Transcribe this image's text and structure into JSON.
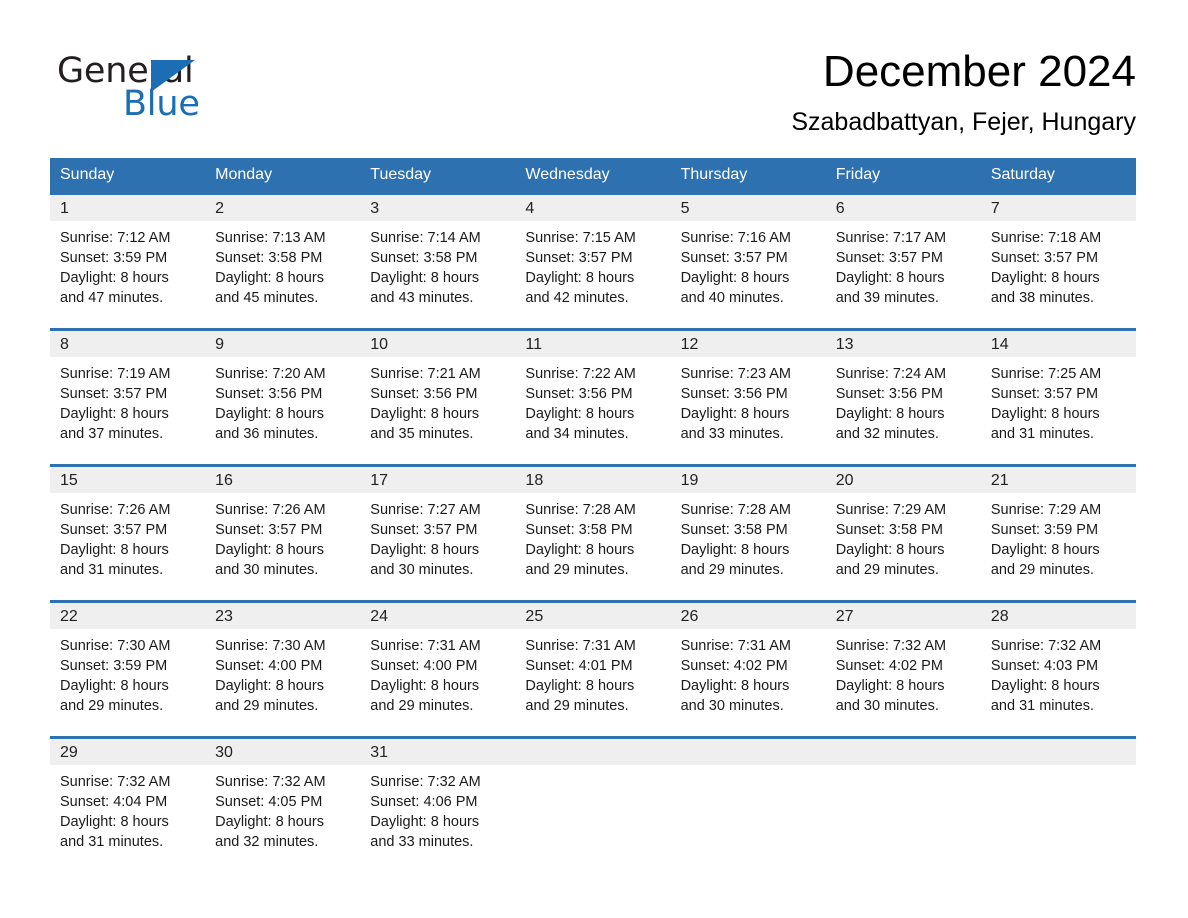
{
  "brand": {
    "name_part1": "General",
    "name_part2": "Blue",
    "accent_color": "#1b6eb3"
  },
  "header": {
    "title": "December 2024",
    "subtitle": "Szabadbattyan, Fejer, Hungary"
  },
  "calendar": {
    "header_color": "#2e71b0",
    "date_strip_color": "#efefef",
    "weekdays": [
      "Sunday",
      "Monday",
      "Tuesday",
      "Wednesday",
      "Thursday",
      "Friday",
      "Saturday"
    ],
    "weeks": [
      [
        {
          "date": "1",
          "sunrise": "Sunrise: 7:12 AM",
          "sunset": "Sunset: 3:59 PM",
          "daylight_line1": "Daylight: 8 hours",
          "daylight_line2": "and 47 minutes."
        },
        {
          "date": "2",
          "sunrise": "Sunrise: 7:13 AM",
          "sunset": "Sunset: 3:58 PM",
          "daylight_line1": "Daylight: 8 hours",
          "daylight_line2": "and 45 minutes."
        },
        {
          "date": "3",
          "sunrise": "Sunrise: 7:14 AM",
          "sunset": "Sunset: 3:58 PM",
          "daylight_line1": "Daylight: 8 hours",
          "daylight_line2": "and 43 minutes."
        },
        {
          "date": "4",
          "sunrise": "Sunrise: 7:15 AM",
          "sunset": "Sunset: 3:57 PM",
          "daylight_line1": "Daylight: 8 hours",
          "daylight_line2": "and 42 minutes."
        },
        {
          "date": "5",
          "sunrise": "Sunrise: 7:16 AM",
          "sunset": "Sunset: 3:57 PM",
          "daylight_line1": "Daylight: 8 hours",
          "daylight_line2": "and 40 minutes."
        },
        {
          "date": "6",
          "sunrise": "Sunrise: 7:17 AM",
          "sunset": "Sunset: 3:57 PM",
          "daylight_line1": "Daylight: 8 hours",
          "daylight_line2": "and 39 minutes."
        },
        {
          "date": "7",
          "sunrise": "Sunrise: 7:18 AM",
          "sunset": "Sunset: 3:57 PM",
          "daylight_line1": "Daylight: 8 hours",
          "daylight_line2": "and 38 minutes."
        }
      ],
      [
        {
          "date": "8",
          "sunrise": "Sunrise: 7:19 AM",
          "sunset": "Sunset: 3:57 PM",
          "daylight_line1": "Daylight: 8 hours",
          "daylight_line2": "and 37 minutes."
        },
        {
          "date": "9",
          "sunrise": "Sunrise: 7:20 AM",
          "sunset": "Sunset: 3:56 PM",
          "daylight_line1": "Daylight: 8 hours",
          "daylight_line2": "and 36 minutes."
        },
        {
          "date": "10",
          "sunrise": "Sunrise: 7:21 AM",
          "sunset": "Sunset: 3:56 PM",
          "daylight_line1": "Daylight: 8 hours",
          "daylight_line2": "and 35 minutes."
        },
        {
          "date": "11",
          "sunrise": "Sunrise: 7:22 AM",
          "sunset": "Sunset: 3:56 PM",
          "daylight_line1": "Daylight: 8 hours",
          "daylight_line2": "and 34 minutes."
        },
        {
          "date": "12",
          "sunrise": "Sunrise: 7:23 AM",
          "sunset": "Sunset: 3:56 PM",
          "daylight_line1": "Daylight: 8 hours",
          "daylight_line2": "and 33 minutes."
        },
        {
          "date": "13",
          "sunrise": "Sunrise: 7:24 AM",
          "sunset": "Sunset: 3:56 PM",
          "daylight_line1": "Daylight: 8 hours",
          "daylight_line2": "and 32 minutes."
        },
        {
          "date": "14",
          "sunrise": "Sunrise: 7:25 AM",
          "sunset": "Sunset: 3:57 PM",
          "daylight_line1": "Daylight: 8 hours",
          "daylight_line2": "and 31 minutes."
        }
      ],
      [
        {
          "date": "15",
          "sunrise": "Sunrise: 7:26 AM",
          "sunset": "Sunset: 3:57 PM",
          "daylight_line1": "Daylight: 8 hours",
          "daylight_line2": "and 31 minutes."
        },
        {
          "date": "16",
          "sunrise": "Sunrise: 7:26 AM",
          "sunset": "Sunset: 3:57 PM",
          "daylight_line1": "Daylight: 8 hours",
          "daylight_line2": "and 30 minutes."
        },
        {
          "date": "17",
          "sunrise": "Sunrise: 7:27 AM",
          "sunset": "Sunset: 3:57 PM",
          "daylight_line1": "Daylight: 8 hours",
          "daylight_line2": "and 30 minutes."
        },
        {
          "date": "18",
          "sunrise": "Sunrise: 7:28 AM",
          "sunset": "Sunset: 3:58 PM",
          "daylight_line1": "Daylight: 8 hours",
          "daylight_line2": "and 29 minutes."
        },
        {
          "date": "19",
          "sunrise": "Sunrise: 7:28 AM",
          "sunset": "Sunset: 3:58 PM",
          "daylight_line1": "Daylight: 8 hours",
          "daylight_line2": "and 29 minutes."
        },
        {
          "date": "20",
          "sunrise": "Sunrise: 7:29 AM",
          "sunset": "Sunset: 3:58 PM",
          "daylight_line1": "Daylight: 8 hours",
          "daylight_line2": "and 29 minutes."
        },
        {
          "date": "21",
          "sunrise": "Sunrise: 7:29 AM",
          "sunset": "Sunset: 3:59 PM",
          "daylight_line1": "Daylight: 8 hours",
          "daylight_line2": "and 29 minutes."
        }
      ],
      [
        {
          "date": "22",
          "sunrise": "Sunrise: 7:30 AM",
          "sunset": "Sunset: 3:59 PM",
          "daylight_line1": "Daylight: 8 hours",
          "daylight_line2": "and 29 minutes."
        },
        {
          "date": "23",
          "sunrise": "Sunrise: 7:30 AM",
          "sunset": "Sunset: 4:00 PM",
          "daylight_line1": "Daylight: 8 hours",
          "daylight_line2": "and 29 minutes."
        },
        {
          "date": "24",
          "sunrise": "Sunrise: 7:31 AM",
          "sunset": "Sunset: 4:00 PM",
          "daylight_line1": "Daylight: 8 hours",
          "daylight_line2": "and 29 minutes."
        },
        {
          "date": "25",
          "sunrise": "Sunrise: 7:31 AM",
          "sunset": "Sunset: 4:01 PM",
          "daylight_line1": "Daylight: 8 hours",
          "daylight_line2": "and 29 minutes."
        },
        {
          "date": "26",
          "sunrise": "Sunrise: 7:31 AM",
          "sunset": "Sunset: 4:02 PM",
          "daylight_line1": "Daylight: 8 hours",
          "daylight_line2": "and 30 minutes."
        },
        {
          "date": "27",
          "sunrise": "Sunrise: 7:32 AM",
          "sunset": "Sunset: 4:02 PM",
          "daylight_line1": "Daylight: 8 hours",
          "daylight_line2": "and 30 minutes."
        },
        {
          "date": "28",
          "sunrise": "Sunrise: 7:32 AM",
          "sunset": "Sunset: 4:03 PM",
          "daylight_line1": "Daylight: 8 hours",
          "daylight_line2": "and 31 minutes."
        }
      ],
      [
        {
          "date": "29",
          "sunrise": "Sunrise: 7:32 AM",
          "sunset": "Sunset: 4:04 PM",
          "daylight_line1": "Daylight: 8 hours",
          "daylight_line2": "and 31 minutes."
        },
        {
          "date": "30",
          "sunrise": "Sunrise: 7:32 AM",
          "sunset": "Sunset: 4:05 PM",
          "daylight_line1": "Daylight: 8 hours",
          "daylight_line2": "and 32 minutes."
        },
        {
          "date": "31",
          "sunrise": "Sunrise: 7:32 AM",
          "sunset": "Sunset: 4:06 PM",
          "daylight_line1": "Daylight: 8 hours",
          "daylight_line2": "and 33 minutes."
        },
        {
          "date": "",
          "sunrise": "",
          "sunset": "",
          "daylight_line1": "",
          "daylight_line2": ""
        },
        {
          "date": "",
          "sunrise": "",
          "sunset": "",
          "daylight_line1": "",
          "daylight_line2": ""
        },
        {
          "date": "",
          "sunrise": "",
          "sunset": "",
          "daylight_line1": "",
          "daylight_line2": ""
        },
        {
          "date": "",
          "sunrise": "",
          "sunset": "",
          "daylight_line1": "",
          "daylight_line2": ""
        }
      ]
    ]
  }
}
